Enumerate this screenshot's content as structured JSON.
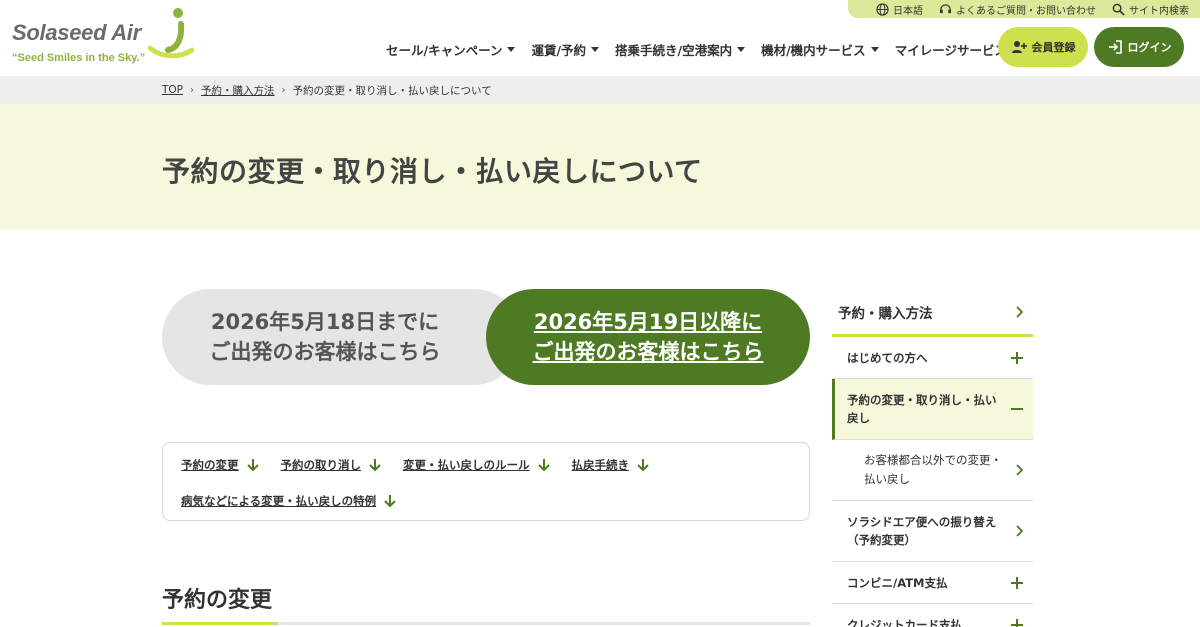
{
  "header": {
    "logo_text": "Solaseed Air",
    "logo_tagline": "“Seed Smiles in the Sky.”",
    "topbar": [
      {
        "label": "日本語",
        "icon": "globe-icon"
      },
      {
        "label": "よくあるご質問・お問い合わせ",
        "icon": "headset-icon"
      },
      {
        "label": "サイト内検索",
        "icon": "search-icon"
      }
    ],
    "nav": [
      {
        "label": "セール/キャンペーン"
      },
      {
        "label": "運賃/予約"
      },
      {
        "label": "搭乗手続き/空港案内"
      },
      {
        "label": "機材/機内サービス"
      },
      {
        "label": "マイレージサービス"
      }
    ],
    "register_label": "会員登録",
    "login_label": "ログイン",
    "colors": {
      "lime": "#cfe04f",
      "green": "#4f7a24",
      "pale": "#f6f8dc"
    }
  },
  "breadcrumb": {
    "items": [
      "TOP",
      "予約・購入方法",
      "予約の変更・取り消し・払い戻しについて"
    ]
  },
  "hero": {
    "title": "予約の変更・取り消し・払い戻しについて"
  },
  "date_switch": {
    "left_line1": "2026年5月18日までに",
    "left_line2": "ご出発のお客様はこちら",
    "right_line1": "2026年5月19日以降に",
    "right_line2": "ご出発のお客様はこちら"
  },
  "anchors": {
    "row1": [
      "予約の変更",
      "予約の取り消し",
      "変更・払い戻しのルール",
      "払戻手続き"
    ],
    "row2": [
      "病気などによる変更・払い戻しの特例"
    ]
  },
  "section": {
    "title": "予約の変更"
  },
  "sidenav": {
    "heading": "予約・購入方法",
    "items": [
      {
        "label": "はじめての方へ",
        "icon": "plus-icon"
      },
      {
        "label_line1": "予約の変更・取り消し・払い",
        "label_line2": "戻し",
        "icon": "minus-icon"
      },
      {
        "label_line1": "お客様都合以外での変更・",
        "label_line2": "払い戻し",
        "icon": "chevron-right-icon"
      },
      {
        "label_line1": "ソラシドエア便への振り替え",
        "label_line2": "（予約変更）",
        "icon": "chevron-right-icon"
      },
      {
        "label": "コンビニ/ATM支払",
        "icon": "plus-icon"
      },
      {
        "label": "クレジットカード支払",
        "icon": "plus-icon"
      }
    ]
  }
}
